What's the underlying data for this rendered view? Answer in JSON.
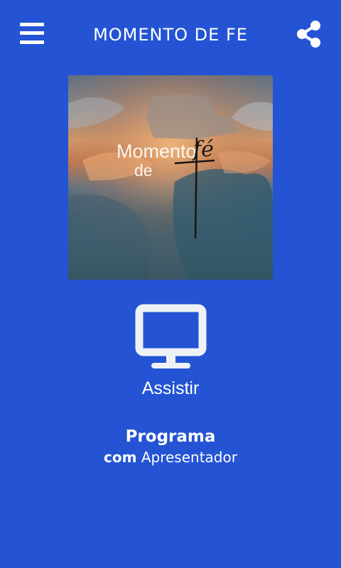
{
  "app": {
    "title": "MOMENTO DE FE"
  },
  "icons": {
    "menu": "menu-icon",
    "share": "share-icon",
    "watch": "monitor-icon"
  },
  "cover": {
    "line1": "Momento",
    "line2": "de",
    "line3": "fé"
  },
  "watch": {
    "label": "Assistir"
  },
  "program": {
    "name": "Programa",
    "host_prefix": "com",
    "host_name": "Apresentador"
  },
  "colors": {
    "background": "#2454d4",
    "foreground": "#ffffff",
    "icon": "#eef2f5"
  }
}
